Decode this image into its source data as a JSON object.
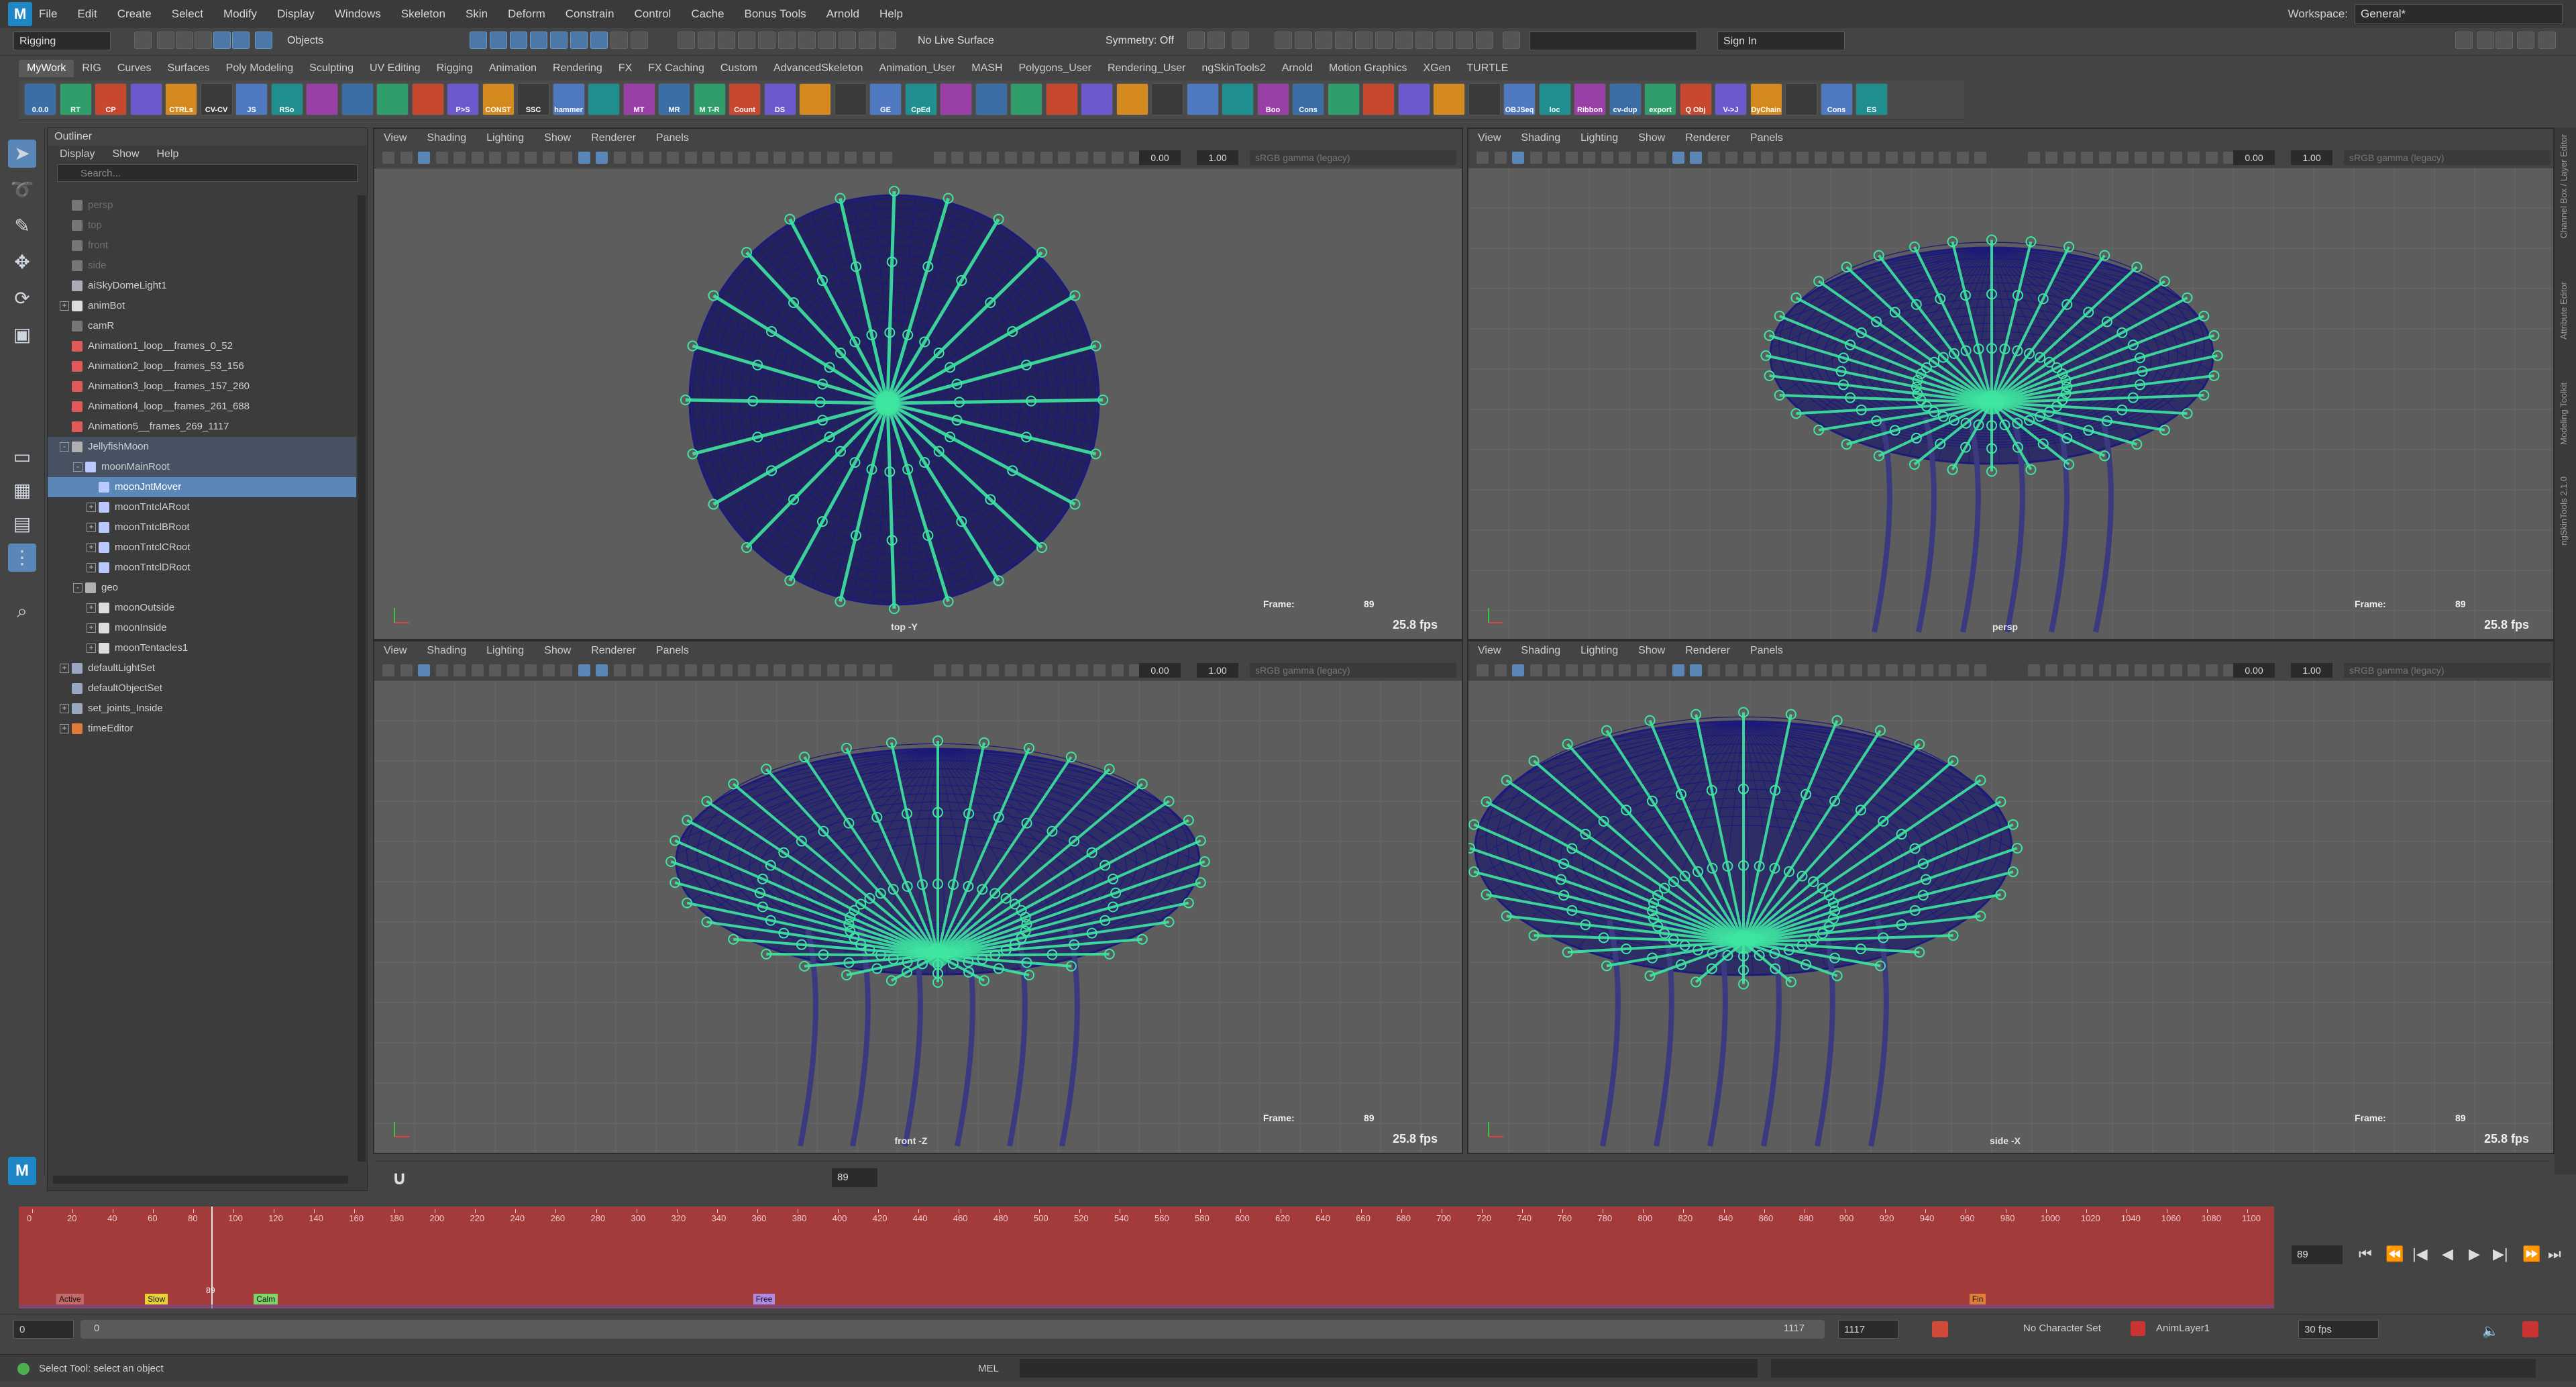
{
  "menubar": {
    "logo": "M",
    "items": [
      "File",
      "Edit",
      "Create",
      "Select",
      "Modify",
      "Display",
      "Windows",
      "Skeleton",
      "Skin",
      "Deform",
      "Constrain",
      "Control",
      "Cache",
      "Bonus Tools",
      "Arnold",
      "Help"
    ],
    "workspace_label": "Workspace:",
    "workspace_value": "General*"
  },
  "statusline": {
    "mode": "Rigging",
    "select_mode": "Objects",
    "live_surface": "No Live Surface",
    "symmetry": "Symmetry: Off",
    "sign_in": "Sign In"
  },
  "shelf": {
    "tabs": [
      "MyWork",
      "RIG",
      "Curves",
      "Surfaces",
      "Poly Modeling",
      "Sculpting",
      "UV Editing",
      "Rigging",
      "Animation",
      "Rendering",
      "FX",
      "FX Caching",
      "Custom",
      "AdvancedSkeleton",
      "Animation_User",
      "MASH",
      "Polygons_User",
      "Rendering_User",
      "ngSkinTools2",
      "Arnold",
      "Motion Graphics",
      "XGen",
      "TURTLE"
    ],
    "active_tab": "MyWork",
    "buttons": [
      "0.0.0",
      "RT",
      "CP",
      "",
      "CTRLs",
      "CV-CV",
      "JS",
      "RSo",
      "",
      "",
      "",
      "",
      "P>S",
      "CONST",
      "SSC",
      "hammer",
      "",
      "MT",
      "MR",
      "M T-R",
      "Count",
      "DS",
      "",
      "",
      "GE",
      "CpEd",
      "",
      "",
      "",
      "",
      "",
      "",
      "",
      "",
      "",
      "Boo",
      "Cons",
      "",
      "",
      "",
      "",
      "",
      "OBJSeq",
      "loc",
      "Ribbon",
      "cv-dup",
      "export",
      "Q Obj",
      "V->J",
      "DyChain",
      "",
      "Cons",
      "ES"
    ]
  },
  "outliner": {
    "title": "Outliner",
    "menu": [
      "Display",
      "Show",
      "Help"
    ],
    "search_placeholder": "Search...",
    "rows": [
      {
        "label": "persp",
        "indent": 1,
        "type": "camera",
        "dim": true
      },
      {
        "label": "top",
        "indent": 1,
        "type": "camera",
        "dim": true
      },
      {
        "label": "front",
        "indent": 1,
        "type": "camera",
        "dim": true
      },
      {
        "label": "side",
        "indent": 1,
        "type": "camera",
        "dim": true
      },
      {
        "label": "aiSkyDomeLight1",
        "indent": 1,
        "type": "light"
      },
      {
        "label": "animBot",
        "indent": 1,
        "type": "magnet",
        "exp": "+"
      },
      {
        "label": "camR",
        "indent": 1,
        "type": "camera"
      },
      {
        "label": "Animation1_loop__frames_0_52",
        "indent": 1,
        "type": "set"
      },
      {
        "label": "Animation2_loop__frames_53_156",
        "indent": 1,
        "type": "set"
      },
      {
        "label": "Animation3_loop__frames_157_260",
        "indent": 1,
        "type": "set"
      },
      {
        "label": "Animation4_loop__frames_261_688",
        "indent": 1,
        "type": "set"
      },
      {
        "label": "Animation5__frames_269_1117",
        "indent": 1,
        "type": "set"
      },
      {
        "label": "JellyfishMoon",
        "indent": 1,
        "type": "group",
        "exp": "-",
        "group": true
      },
      {
        "label": "moonMainRoot",
        "indent": 2,
        "type": "joint",
        "exp": "-",
        "group": true
      },
      {
        "label": "moonJntMover",
        "indent": 3,
        "type": "joint",
        "selected": true
      },
      {
        "label": "moonTntclARoot",
        "indent": 3,
        "type": "joint",
        "exp": "+"
      },
      {
        "label": "moonTntclBRoot",
        "indent": 3,
        "type": "joint",
        "exp": "+"
      },
      {
        "label": "moonTntclCRoot",
        "indent": 3,
        "type": "joint",
        "exp": "+"
      },
      {
        "label": "moonTntclDRoot",
        "indent": 3,
        "type": "joint",
        "exp": "+"
      },
      {
        "label": "geo",
        "indent": 2,
        "type": "group",
        "exp": "-"
      },
      {
        "label": "moonOutside",
        "indent": 3,
        "type": "mesh",
        "exp": "+"
      },
      {
        "label": "moonInside",
        "indent": 3,
        "type": "mesh",
        "exp": "+"
      },
      {
        "label": "moonTentacles1",
        "indent": 3,
        "type": "mesh",
        "exp": "+"
      },
      {
        "label": "defaultLightSet",
        "indent": 1,
        "type": "objset",
        "exp": "+"
      },
      {
        "label": "defaultObjectSet",
        "indent": 1,
        "type": "objset"
      },
      {
        "label": "set_joints_Inside",
        "indent": 1,
        "type": "objset",
        "exp": "+"
      },
      {
        "label": "timeEditor",
        "indent": 1,
        "type": "editor",
        "exp": "+"
      }
    ]
  },
  "viewports": {
    "menu": [
      "View",
      "Shading",
      "Lighting",
      "Show",
      "Renderer",
      "Panels"
    ],
    "field_a": "0.00",
    "field_b": "1.00",
    "gamma": "sRGB gamma (legacy)",
    "frame_label": "Frame:",
    "frame_value": "89",
    "fps": "25.8 fps",
    "panels": [
      {
        "camera": "top -Y"
      },
      {
        "camera": "persp"
      },
      {
        "camera": "front -Z"
      },
      {
        "camera": "side -X"
      }
    ]
  },
  "sidestrip": [
    "Channel Box / Layer Editor",
    "Attribute Editor",
    "Modeling Toolkit",
    "ngSkinTools 2.1.0"
  ],
  "timeline": {
    "ticks": [
      "0",
      "20",
      "40",
      "60",
      "80",
      "100",
      "120",
      "140",
      "160",
      "180",
      "200",
      "220",
      "240",
      "260",
      "280",
      "300",
      "320",
      "340",
      "360",
      "380",
      "400",
      "420",
      "440",
      "460",
      "480",
      "500",
      "520",
      "540",
      "560",
      "580",
      "600",
      "620",
      "640",
      "660",
      "680",
      "700",
      "720",
      "740",
      "760",
      "780",
      "800",
      "820",
      "840",
      "860",
      "880",
      "900",
      "920",
      "940",
      "960",
      "980",
      "1000",
      "1020",
      "1040",
      "1060",
      "1080",
      "1100"
    ],
    "current": "89",
    "markers": [
      {
        "label": "Active",
        "frame": 12,
        "color": "#c46a6a"
      },
      {
        "label": "Slow",
        "frame": 56,
        "color": "#e8d13a"
      },
      {
        "label": "Calm",
        "frame": 110,
        "color": "#7fd36a"
      },
      {
        "label": "Free",
        "frame": 358,
        "color": "#b08ae0"
      },
      {
        "label": "Fin",
        "frame": 962,
        "color": "#e07e3a"
      }
    ],
    "current_field": "89"
  },
  "range": {
    "start": "0",
    "inner_start": "0",
    "inner_end": "1117",
    "end": "1117",
    "character_set": "No Character Set",
    "anim_layer": "AnimLayer1",
    "fps": "30 fps"
  },
  "cmdline": {
    "help_text": "Select Tool: select an object",
    "lang": "MEL"
  },
  "colors": {
    "joint": "#3ee6a0",
    "wire": "#1c1a7a",
    "timeline": "#a33b3b",
    "selection": "#5a86b8"
  }
}
